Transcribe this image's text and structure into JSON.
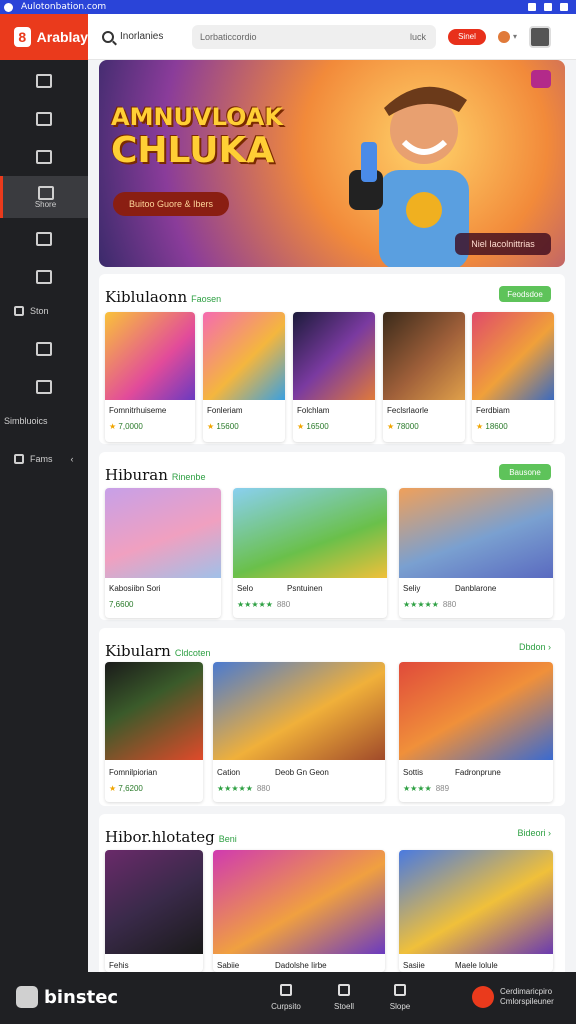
{
  "browser": {
    "url": "Aulotonbation.com"
  },
  "app": {
    "logo_text": "Arablay"
  },
  "header": {
    "search_label": "Inorlanies",
    "search_placeholder": "Lorbaticcordio",
    "search_hint": "luck",
    "cta_label": "Sinel"
  },
  "sidebar": {
    "items": [
      {
        "label": "",
        "icon": "monitor-icon"
      },
      {
        "label": "",
        "icon": "triangle-icon"
      },
      {
        "label": "",
        "icon": "box-icon"
      },
      {
        "label": "Shore",
        "icon": "home-icon"
      },
      {
        "label": "",
        "icon": "puzzle-icon"
      },
      {
        "label": "",
        "icon": "layers-icon"
      },
      {
        "label": "Ston",
        "icon": "controller-icon"
      },
      {
        "label": "",
        "icon": "tag-icon"
      },
      {
        "label": "",
        "icon": "grid-icon"
      },
      {
        "label": "Simbluoics",
        "icon": "chart-icon"
      },
      {
        "label": "Fams",
        "icon": "people-icon"
      }
    ]
  },
  "hero": {
    "title_line1": "AMNUVLOAK",
    "title_line2": "CHLUKA",
    "cta_primary": "Buitoo Guore & Ibers",
    "cta_secondary": "Niel Iacolnittrias"
  },
  "sections": [
    {
      "title": "Kiblulaonn",
      "subtitle": "Faosen",
      "action": "Feodsdoe",
      "items": [
        {
          "title": "Fomnitrhuiseme",
          "price": "7,0000"
        },
        {
          "title": "Fonleriam",
          "price": "15600"
        },
        {
          "title": "Folchlam",
          "price": "16500"
        },
        {
          "title": "Feclsrlaorle",
          "price": "78000"
        },
        {
          "title": "Ferdbiam",
          "price": "18600"
        }
      ]
    },
    {
      "title": "Hiburan",
      "subtitle": "Rinenbe",
      "action": "Bausone",
      "items": [
        {
          "title": "Kabosiibn Sori",
          "price": "7,6600"
        },
        {
          "title": "Selo",
          "right": "Psntuinen",
          "stars": "★★★★★",
          "count": "880"
        },
        {
          "title": "Seliy",
          "right": "Danblarone",
          "stars": "★★★★★",
          "count": "880"
        }
      ]
    },
    {
      "title": "Kibularn",
      "subtitle": "Cldcoten",
      "action": "Dbdon",
      "items": [
        {
          "title": "Fomnilpiorian",
          "price": "7,6200"
        },
        {
          "title": "Cation",
          "right": "Deob Gn Geon",
          "stars": "★★★★★",
          "count": "880"
        },
        {
          "title": "Sottis",
          "right": "Fadronprune",
          "stars": "★★★★",
          "count": "889"
        }
      ]
    },
    {
      "title": "Hibor.hlotateg",
      "subtitle": "Beni",
      "action": "Bideori",
      "items": [
        {
          "title": "Fehis"
        },
        {
          "title": "Sabiie",
          "right": "Dadolshe Iirbe"
        },
        {
          "title": "Sasiie",
          "right": "Maele lolule"
        }
      ]
    }
  ],
  "footer": {
    "logo_text": "binstec",
    "nav": [
      {
        "label": "Curpsito",
        "icon": "document-icon"
      },
      {
        "label": "Stoell",
        "icon": "heart-icon"
      },
      {
        "label": "Slope",
        "icon": "bag-icon"
      }
    ],
    "right_text": "Cerdimaricpiro Cmlorspileuner"
  },
  "colors": {
    "brand": "#ea3a1c",
    "accent_green": "#5ec35a",
    "sidebar_bg": "#1f2023"
  }
}
